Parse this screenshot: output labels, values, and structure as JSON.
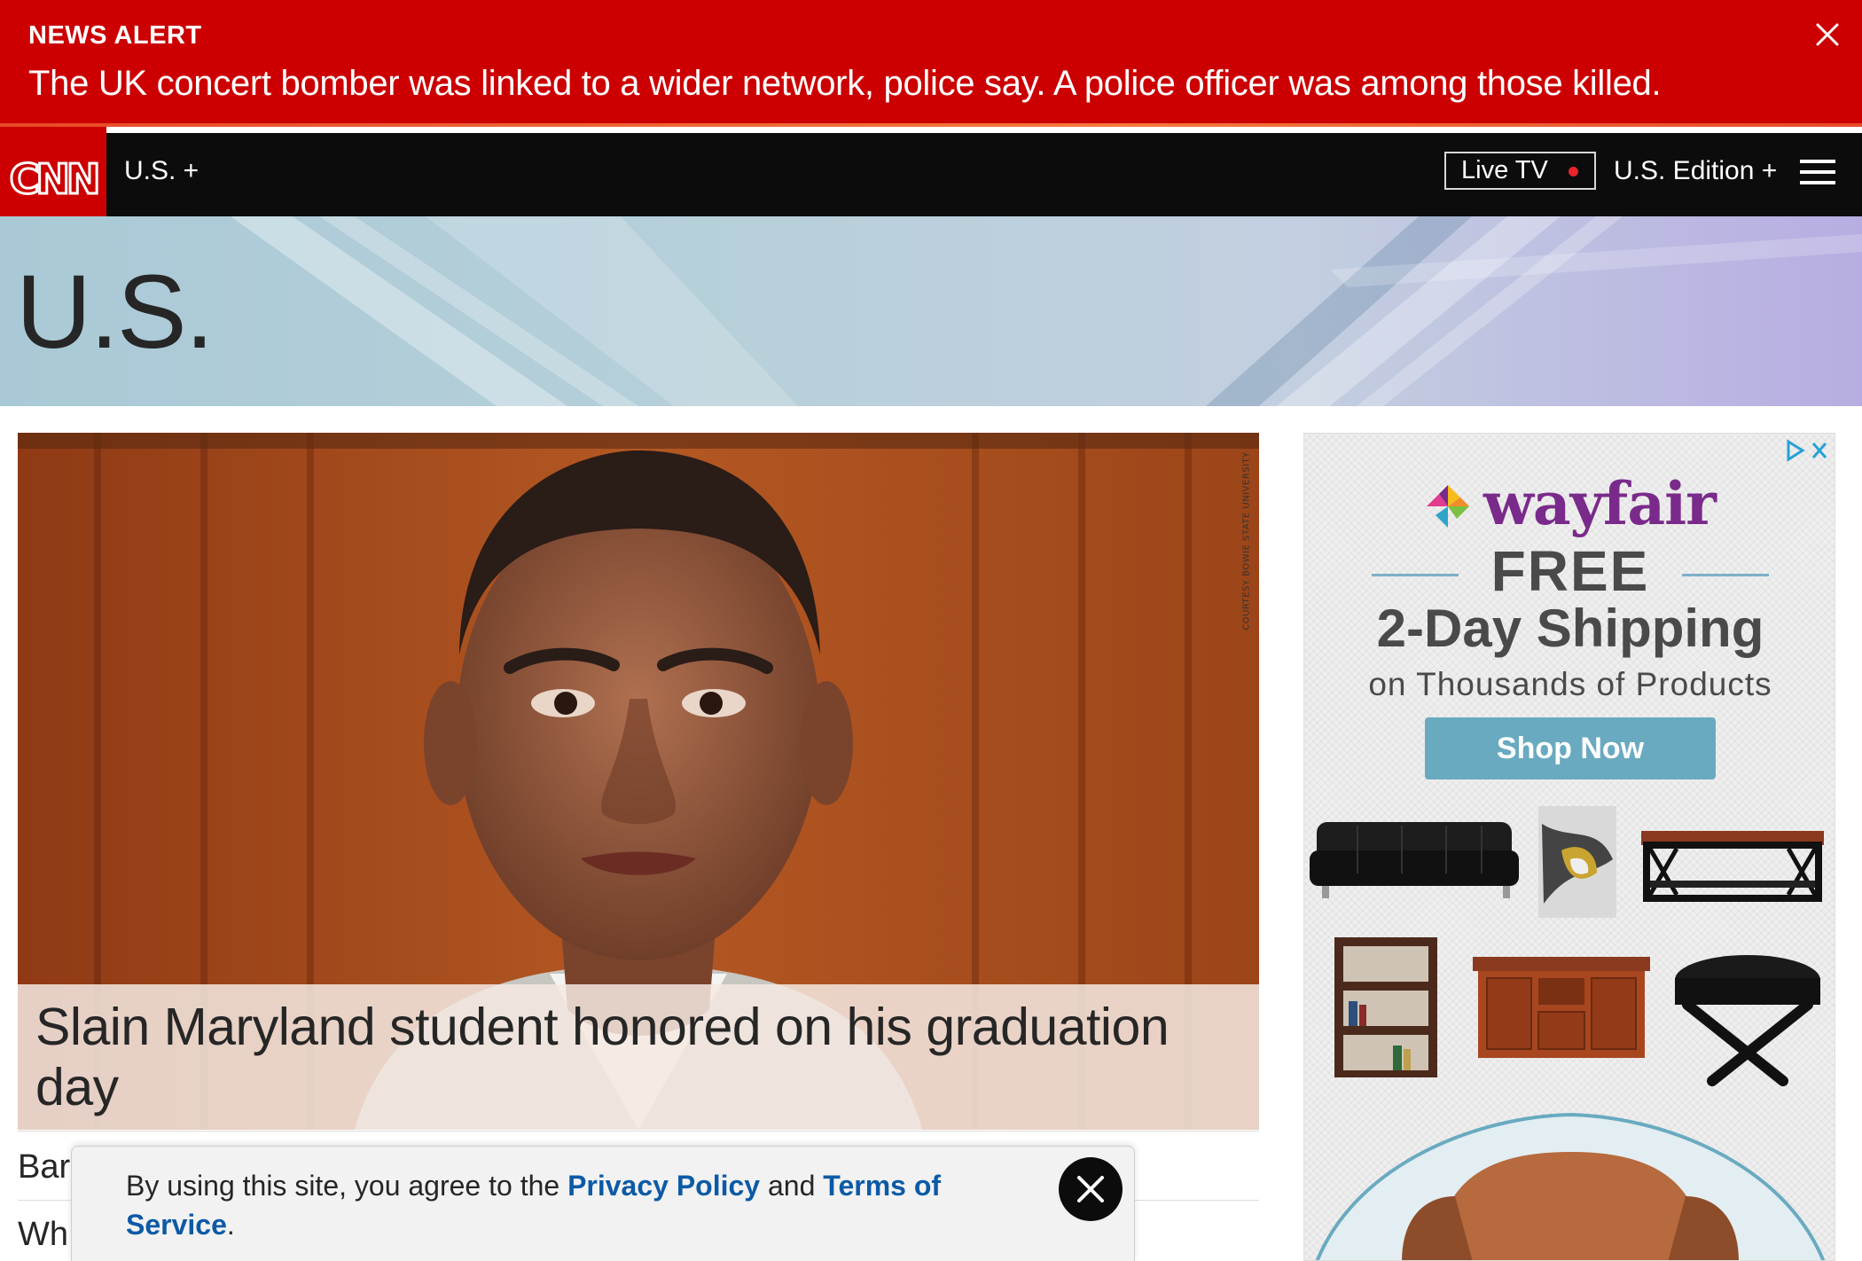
{
  "alert": {
    "label": "NEWS ALERT",
    "text": "The UK concert bomber was linked to a wider network, police say. A police officer was among those killed."
  },
  "nav": {
    "logo_text": "CNN",
    "section": "U.S. +",
    "live_tv": "Live TV",
    "edition": "U.S. Edition +"
  },
  "banner": {
    "title": "U.S."
  },
  "hero": {
    "caption": "Slain Maryland student honored on his graduation day",
    "credit": "COURTESY BOWIE STATE UNIVERSITY"
  },
  "headlines": [
    "Bar",
    "Wh"
  ],
  "consent": {
    "text_before": "By using this site, you agree to the ",
    "privacy_link": "Privacy Policy",
    "text_middle": " and ",
    "terms_link": "Terms of Service",
    "text_after": "."
  },
  "ad": {
    "brand": "wayfair",
    "headline_free": "FREE",
    "headline_shipping": "2-Day Shipping",
    "subline": "on Thousands of Products",
    "cta": "Shop Now"
  },
  "colors": {
    "alert_red": "#cc0000",
    "nav_black": "#0c0c0c",
    "link_blue": "#0c5aa6",
    "wayfair_purple": "#7a2a8a",
    "ad_button": "#6aaac0"
  }
}
